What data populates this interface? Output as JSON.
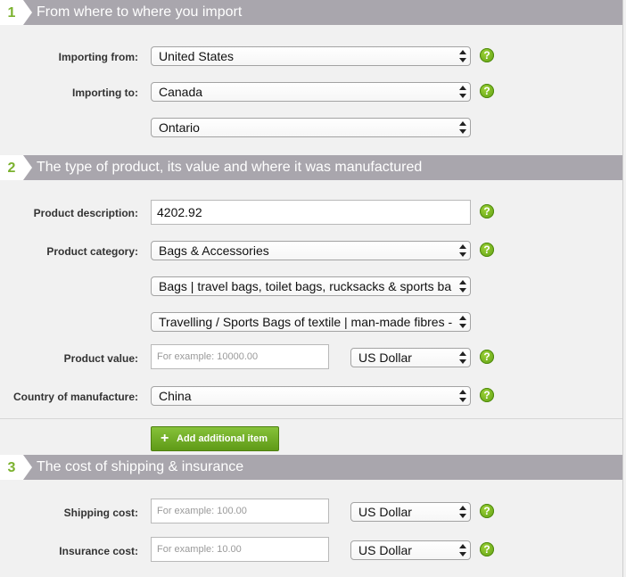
{
  "sections": [
    {
      "number": "1",
      "title": "From where to where you import"
    },
    {
      "number": "2",
      "title": "The type of product, its value and where it was manufactured"
    },
    {
      "number": "3",
      "title": "The cost of shipping & insurance"
    }
  ],
  "import": {
    "from_label": "Importing from:",
    "from_value": "United States",
    "to_label": "Importing to:",
    "to_value": "Canada",
    "province_value": "Ontario"
  },
  "product": {
    "description_label": "Product description:",
    "description_value": "4202.92",
    "category_label": "Product category:",
    "category_value": "Bags & Accessories",
    "subcategory_value": "Bags | travel bags, toilet bags, rucksacks & sports ba",
    "subsubcategory_value": "Travelling / Sports Bags of textile | man-made fibres -",
    "value_label": "Product value:",
    "value_placeholder": "For example: 10000.00",
    "value_currency": "US Dollar",
    "country_label": "Country of manufacture:",
    "country_value": "China",
    "add_item_label": "Add additional item"
  },
  "shipping": {
    "shipping_label": "Shipping cost:",
    "shipping_placeholder": "For example: 100.00",
    "shipping_currency": "US Dollar",
    "insurance_label": "Insurance cost:",
    "insurance_placeholder": "For example: 10.00",
    "insurance_currency": "US Dollar"
  },
  "help_glyph": "?",
  "icons": {
    "help": "question-mark-icon",
    "add": "plus-icon",
    "select": "up-down-arrows-icon"
  },
  "colors": {
    "accent_green": "#7bb22e",
    "header_bar": "#a9a6ad",
    "button_green": "#6fae22"
  }
}
